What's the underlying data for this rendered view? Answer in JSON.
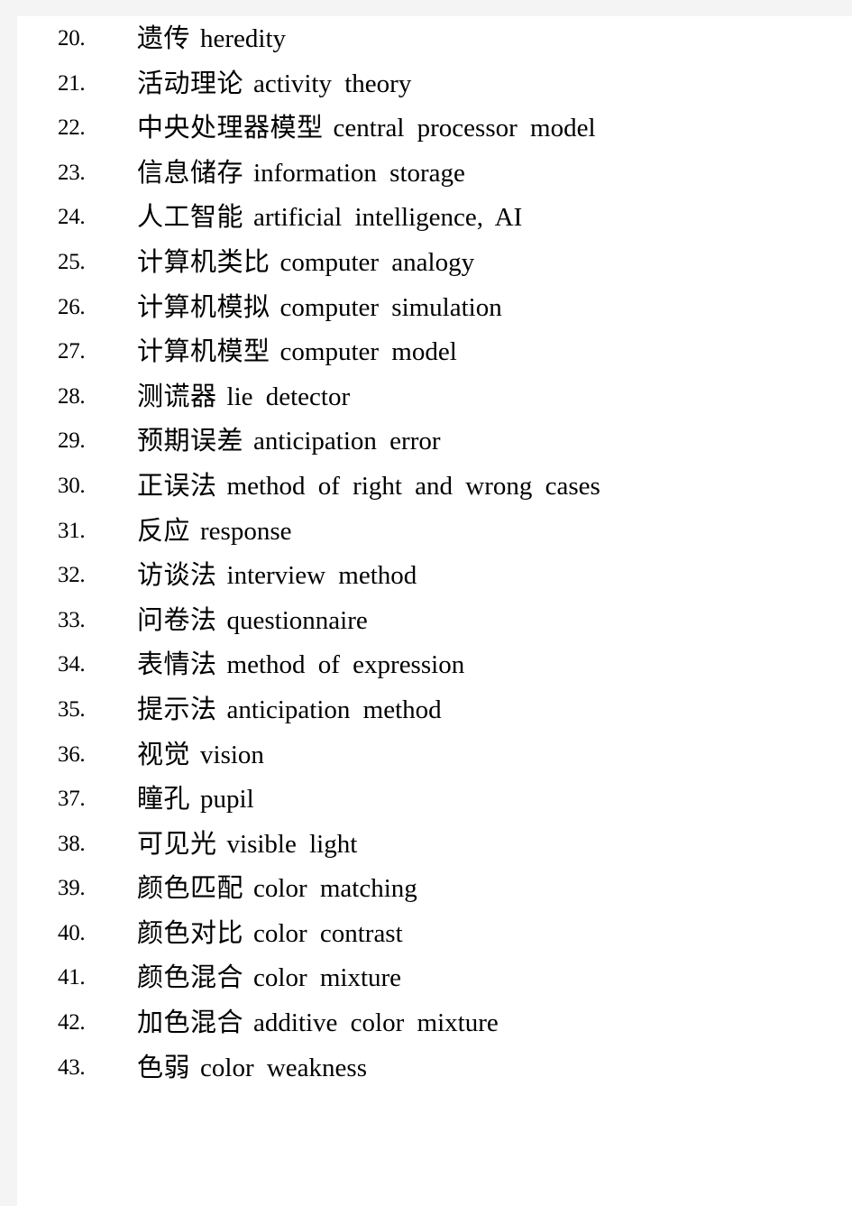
{
  "page": {
    "background_color": "#f4f4f4",
    "sheet_color": "#ffffff",
    "text_color": "#000000"
  },
  "glossary": {
    "entries": [
      {
        "number": "20.",
        "zh": "遗传",
        "en": "heredity"
      },
      {
        "number": "21.",
        "zh": "活动理论",
        "en": "activity theory"
      },
      {
        "number": "22.",
        "zh": "中央处理器模型",
        "en": "central processor model"
      },
      {
        "number": "23.",
        "zh": "信息储存",
        "en": "information storage"
      },
      {
        "number": "24.",
        "zh": "人工智能",
        "en": "artificial intelligence, AI"
      },
      {
        "number": "25.",
        "zh": "计算机类比",
        "en": "computer analogy"
      },
      {
        "number": "26.",
        "zh": "计算机模拟",
        "en": "computer simulation"
      },
      {
        "number": "27.",
        "zh": "计算机模型",
        "en": "computer model"
      },
      {
        "number": "28.",
        "zh": "测谎器",
        "en": "lie detector"
      },
      {
        "number": "29.",
        "zh": "预期误差",
        "en": "anticipation error"
      },
      {
        "number": "30.",
        "zh": "正误法",
        "en": "method of right and wrong cases"
      },
      {
        "number": "31.",
        "zh": "反应",
        "en": "response"
      },
      {
        "number": "32.",
        "zh": "访谈法",
        "en": "interview method"
      },
      {
        "number": "33.",
        "zh": "问卷法",
        "en": "questionnaire"
      },
      {
        "number": "34.",
        "zh": "表情法",
        "en": "method of expression"
      },
      {
        "number": "35.",
        "zh": "提示法",
        "en": "anticipation method"
      },
      {
        "number": "36.",
        "zh": "视觉",
        "en": "vision"
      },
      {
        "number": "37.",
        "zh": "瞳孔",
        "en": "pupil"
      },
      {
        "number": "38.",
        "zh": "可见光",
        "en": "visible light"
      },
      {
        "number": "39.",
        "zh": "颜色匹配",
        "en": "color matching"
      },
      {
        "number": "40.",
        "zh": "颜色对比",
        "en": "color contrast"
      },
      {
        "number": "41.",
        "zh": "颜色混合",
        "en": "color mixture"
      },
      {
        "number": "42.",
        "zh": "加色混合",
        "en": "additive color mixture"
      },
      {
        "number": "43.",
        "zh": "色弱",
        "en": "color weakness"
      }
    ]
  }
}
